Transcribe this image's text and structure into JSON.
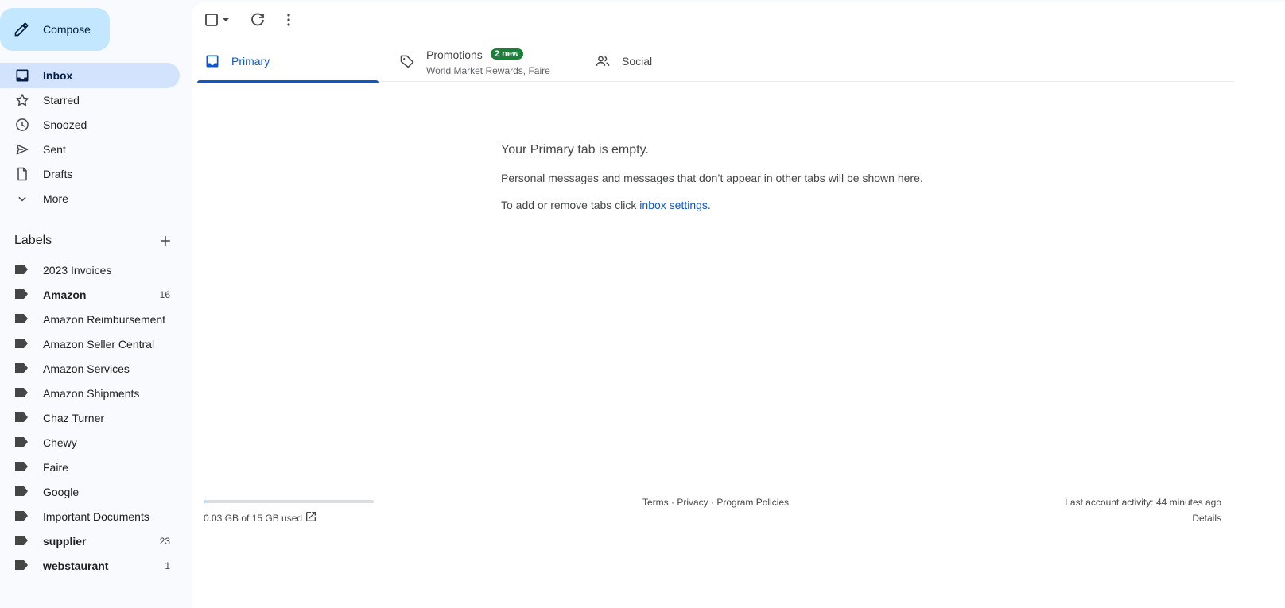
{
  "compose": {
    "label": "Compose"
  },
  "nav": [
    {
      "name": "inbox",
      "label": "Inbox",
      "icon": "inbox-icon",
      "active": true
    },
    {
      "name": "starred",
      "label": "Starred",
      "icon": "star-icon"
    },
    {
      "name": "snoozed",
      "label": "Snoozed",
      "icon": "clock-icon"
    },
    {
      "name": "sent",
      "label": "Sent",
      "icon": "send-icon"
    },
    {
      "name": "drafts",
      "label": "Drafts",
      "icon": "draft-icon"
    },
    {
      "name": "more",
      "label": "More",
      "icon": "chevron-down-icon"
    }
  ],
  "labels_section": {
    "title": "Labels"
  },
  "labels": [
    {
      "label": "2023 Invoices",
      "count": "",
      "bold": false
    },
    {
      "label": "Amazon",
      "count": "16",
      "bold": true
    },
    {
      "label": "Amazon Reimbursement",
      "count": "",
      "bold": false
    },
    {
      "label": "Amazon Seller Central",
      "count": "",
      "bold": false
    },
    {
      "label": "Amazon Services",
      "count": "",
      "bold": false
    },
    {
      "label": "Amazon Shipments",
      "count": "",
      "bold": false
    },
    {
      "label": "Chaz Turner",
      "count": "",
      "bold": false
    },
    {
      "label": "Chewy",
      "count": "",
      "bold": false
    },
    {
      "label": "Faire",
      "count": "",
      "bold": false
    },
    {
      "label": "Google",
      "count": "",
      "bold": false
    },
    {
      "label": "Important Documents",
      "count": "",
      "bold": false
    },
    {
      "label": "supplier",
      "count": "23",
      "bold": true
    },
    {
      "label": "webstaurant",
      "count": "1",
      "bold": true
    }
  ],
  "tabs": {
    "primary": {
      "label": "Primary"
    },
    "promotions": {
      "label": "Promotions",
      "badge": "2 new",
      "sub": "World Market Rewards, Faire"
    },
    "social": {
      "label": "Social"
    }
  },
  "empty_state": {
    "heading": "Your Primary tab is empty.",
    "line1": "Personal messages and messages that don’t appear in other tabs will be shown here.",
    "line2_prefix": "To add or remove tabs click ",
    "line2_link": "inbox settings",
    "line2_suffix": "."
  },
  "footer": {
    "storage_text": "0.03 GB of 15 GB used",
    "storage_used_fraction": 0.002,
    "terms": "Terms",
    "privacy": "Privacy",
    "policies": "Program Policies",
    "sep": " · ",
    "activity": "Last account activity: 44 minutes ago",
    "details": "Details"
  },
  "colors": {
    "accent": "#0b57d0",
    "compose_bg": "#c2e7ff",
    "active_nav": "#d3e3fd",
    "badge": "#188038"
  }
}
